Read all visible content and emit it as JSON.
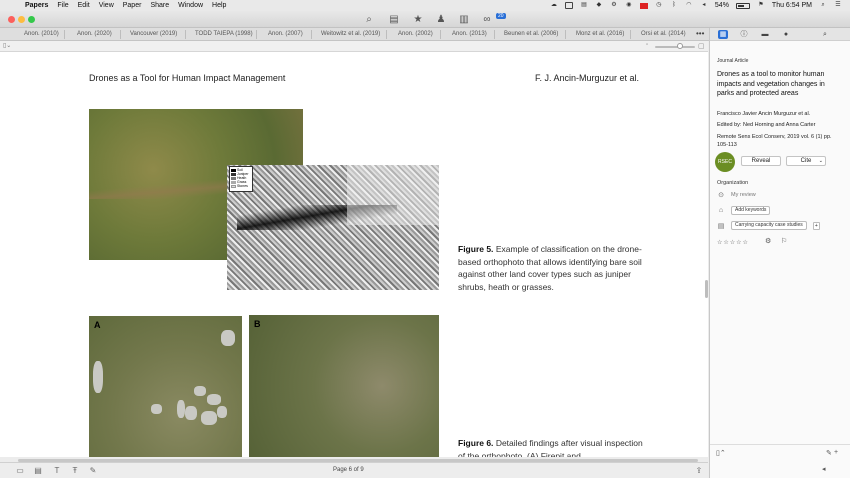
{
  "menubar": {
    "apple": "",
    "items": [
      "Papers",
      "File",
      "Edit",
      "View",
      "Paper",
      "Share",
      "Window",
      "Help"
    ],
    "battery": "54%",
    "clock": "Thu 6:54 PM"
  },
  "toolbar": {
    "badge": "20"
  },
  "tabs": [
    "Anon. (2010)",
    "Anon. (2020)",
    "Vancouver (2019)",
    "TODD TAIEPA (1998)",
    "Anon. (2007)",
    "Weitowitz et al. (2019)",
    "Anon. (2002)",
    "Anon. (2013)",
    "Beunen et al. (2006)",
    "Monz et al. (2016)",
    "Orsi et al. (2014)"
  ],
  "document": {
    "running_head": "Drones as a Tool for Human Impact Management",
    "running_author": "F. J. Ancin-Murguzur et al.",
    "legend": [
      "Soil",
      "Juniper",
      "Heath",
      "Grass",
      "Stones"
    ],
    "figure5_label": "Figure 5.",
    "figure5_text": "Example of classification on the drone-based orthophoto that allows identifying bare soil against other land cover types such as juniper shrubs, heath or grasses.",
    "panel_a": "A",
    "panel_b": "B",
    "figure6_label": "Figure 6.",
    "figure6_text": "Detailed findings after visual inspection of the orthophoto. (A) Firepit and"
  },
  "status": {
    "page_indicator": "Page 6 of 9"
  },
  "inspector": {
    "type": "Journal Article",
    "title": "Drones as a tool to monitor human impacts and vegetation changes in parks and protected areas",
    "authors": "Francisco Javier Ancin Murguzur et al.",
    "edited": "Edited by: Ned Horning and Anna Carter",
    "journal": "Remote Sens Ecol Conserv, 2019 vol. 6 (1) pp. 105-113",
    "avatar_text": "RSEC",
    "reveal_label": "Reveal",
    "cite_label": "Cite",
    "organization_label": "Organization",
    "my_review": "My review",
    "add_keywords": "Add keywords",
    "collection": "Carrying capacity case studies",
    "stars": "☆☆☆☆☆"
  }
}
